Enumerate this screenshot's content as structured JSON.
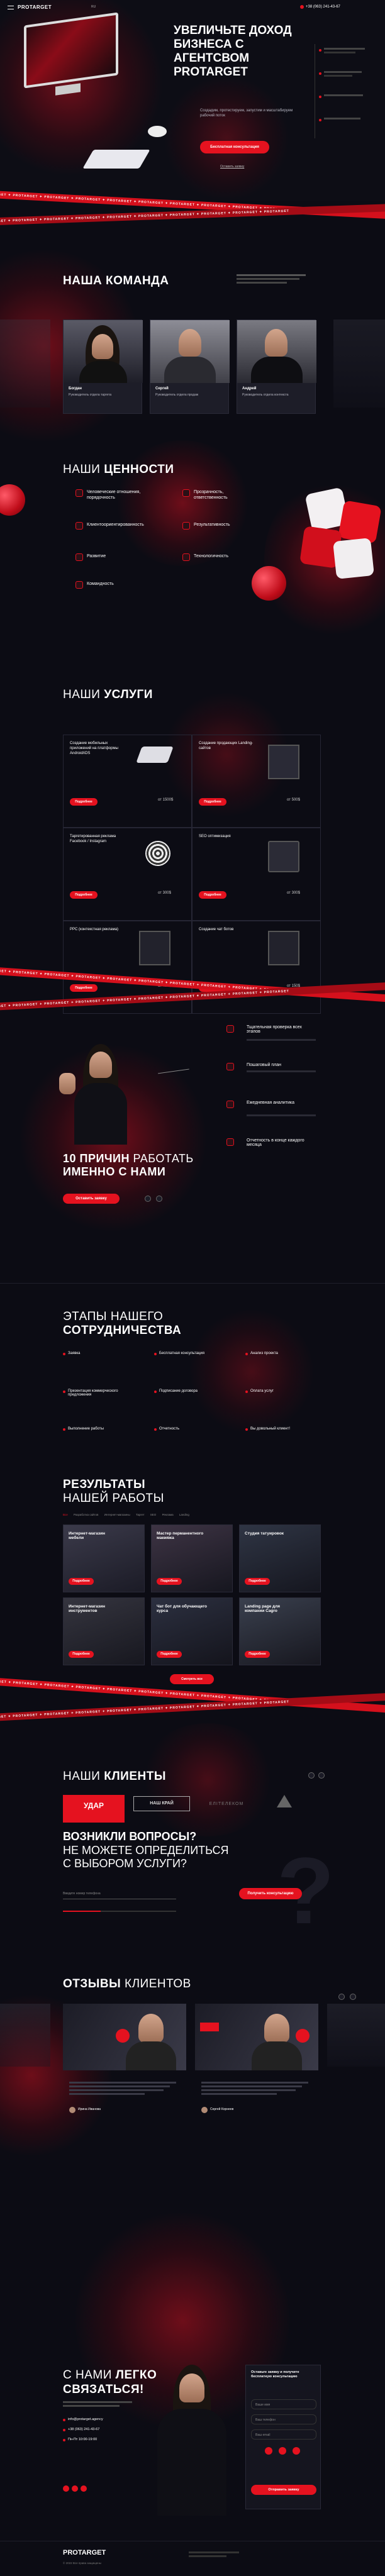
{
  "header": {
    "logo": "PROTARGET",
    "lang": "RU",
    "phone": "+38 (063) 241-43-67"
  },
  "hero": {
    "title": "УВЕЛИЧЬТЕ ДОХОД БИЗНЕСА С АГЕНТСВОМ PROTARGET",
    "subtitle": "Создадим, протестируем, запустим и масштабируем рабочий поток",
    "cta": "Бесплатная консультация",
    "cta2": "Оставить заявку"
  },
  "tape": {
    "text": "PROTARGET ✦ PROTARGET ✦ PROTARGET ✦ PROTARGET ✦ PROTARGET ✦ PROTARGET ✦ PROTARGET ✦ PROTARGET ✦ PROTARGET ✦ PROTARGET"
  },
  "team": {
    "title": "НАША КОМАНДА",
    "members": [
      {
        "name": "Богдан",
        "role": "Руководитель отдела таргета"
      },
      {
        "name": "Сергей",
        "role": "Руководитель отдела продаж"
      },
      {
        "name": "Андрей",
        "role": "Руководитель отдела контекста"
      }
    ]
  },
  "values": {
    "title_a": "НАШИ ",
    "title_b": "ЦЕННОСТИ",
    "items": [
      {
        "label": "Человеческие отношения, порядочность"
      },
      {
        "label": "Прозрачность, ответственность"
      },
      {
        "label": "Клиентоориентированность"
      },
      {
        "label": "Результативность"
      },
      {
        "label": "Развитие"
      },
      {
        "label": "Технологичность"
      },
      {
        "label": "Командность"
      }
    ]
  },
  "services": {
    "title_a": "НАШИ ",
    "title_b": "УСЛУГИ",
    "items": [
      {
        "title": "Создание мобильных приложений на платформы Android/iOS",
        "price": "от 1500$",
        "btn": "Подробнее"
      },
      {
        "title": "Создание продающих Landing-сайтов",
        "price": "от 500$",
        "btn": "Подробнее"
      },
      {
        "title": "Таргетированная реклама Facebook / Instagram",
        "price": "от 300$",
        "btn": "Подробнее"
      },
      {
        "title": "SEO оптимизация",
        "price": "от 300$",
        "btn": "Подробнее"
      },
      {
        "title": "PPC (контекстная реклама)",
        "price": "от 400$",
        "btn": "Подробнее"
      },
      {
        "title": "Создание чат ботов",
        "price": "от 150$",
        "btn": "Подробнее"
      }
    ]
  },
  "reasons": {
    "title_a": "10 ПРИЧИН ",
    "title_b": "РАБОТАТЬ",
    "title_c": "ИМЕННО С НАМИ",
    "cta": "Оставить заявку",
    "items": [
      {
        "label": "Тщательная проверка всех этапов"
      },
      {
        "label": "Пошаговый план"
      },
      {
        "label": "Ежедневная аналитика"
      },
      {
        "label": "Отчетность в конце каждого месяца"
      }
    ]
  },
  "stages": {
    "title_a": "ЭТАПЫ ",
    "title_b": "НАШЕГО",
    "title_c": "СОТРУДНИЧЕСТВА",
    "items": [
      {
        "n": "01",
        "label": "Заявка"
      },
      {
        "n": "02",
        "label": "Бесплатная консультация"
      },
      {
        "n": "03",
        "label": "Анализ проекта"
      },
      {
        "n": "04",
        "label": "Презентация коммерческого предложения"
      },
      {
        "n": "05",
        "label": "Подписание договора"
      },
      {
        "n": "06",
        "label": "Оплата услуг"
      },
      {
        "n": "07",
        "label": "Выполнение работы"
      },
      {
        "n": "08",
        "label": "Отчетность"
      },
      {
        "n": "09",
        "label": "Вы довольный клиент!"
      }
    ]
  },
  "results": {
    "title_a": "РЕЗУЛЬТАТЫ",
    "title_b": "НАШЕЙ РАБОТЫ",
    "tabs": [
      "Все",
      "Разработка сайтов",
      "Интернет-магазины",
      "Таргет",
      "SEO",
      "Реклама",
      "Landing"
    ],
    "items": [
      {
        "title": "Интернет-магазин мебели"
      },
      {
        "title": "Мастер перманентного макияжа"
      },
      {
        "title": "Студия татуировок"
      },
      {
        "title": "Интернет-магазин инструментов"
      },
      {
        "title": "Чат бот для обучающего курса"
      },
      {
        "title": "Landing page для компании Cagro"
      }
    ],
    "btn": "Подробнее",
    "more": "Смотреть все"
  },
  "clients": {
    "title_a": "НАШИ ",
    "title_b": "КЛИЕНТЫ",
    "logos": [
      "УДАР",
      "НАШ КРАЙ",
      "ЕЛІТЕЛЕКОМ"
    ]
  },
  "question": {
    "q1": "ВОЗНИКЛИ ВОПРОСЫ?",
    "q2": "НЕ МОЖЕТЕ ОПРЕДЕЛИТЬСЯ",
    "q3": "С ВЫБОРОМ УСЛУГИ?",
    "placeholder": "Введите номер телефона",
    "cta": "Получить консультацию"
  },
  "reviews": {
    "title_a": "ОТЗЫВЫ ",
    "title_b": "КЛИЕНТОВ",
    "people": [
      {
        "name": "Ирина Иванова"
      },
      {
        "name": "Сергей Корнеев"
      }
    ]
  },
  "contact": {
    "title_a": "С НАМИ ",
    "title_b": "ЛЕГКО",
    "title_c": "СВЯЗАТЬСЯ!",
    "email": "info@protarget.agency",
    "phone": "+38 (063) 241-43-67",
    "hours": "Пн-Пт 10:00-19:00",
    "form_title": "Оставьте заявку и получите бесплатную консультацию",
    "fields": [
      "Ваше имя",
      "Ваш телефон",
      "Ваш email"
    ],
    "cta": "Отправить заявку"
  },
  "footer": {
    "logo": "PROTARGET",
    "copyright": "© 2022 Все права защищены"
  },
  "colors": {
    "accent": "#e5121f",
    "bg": "#0c0c14"
  }
}
